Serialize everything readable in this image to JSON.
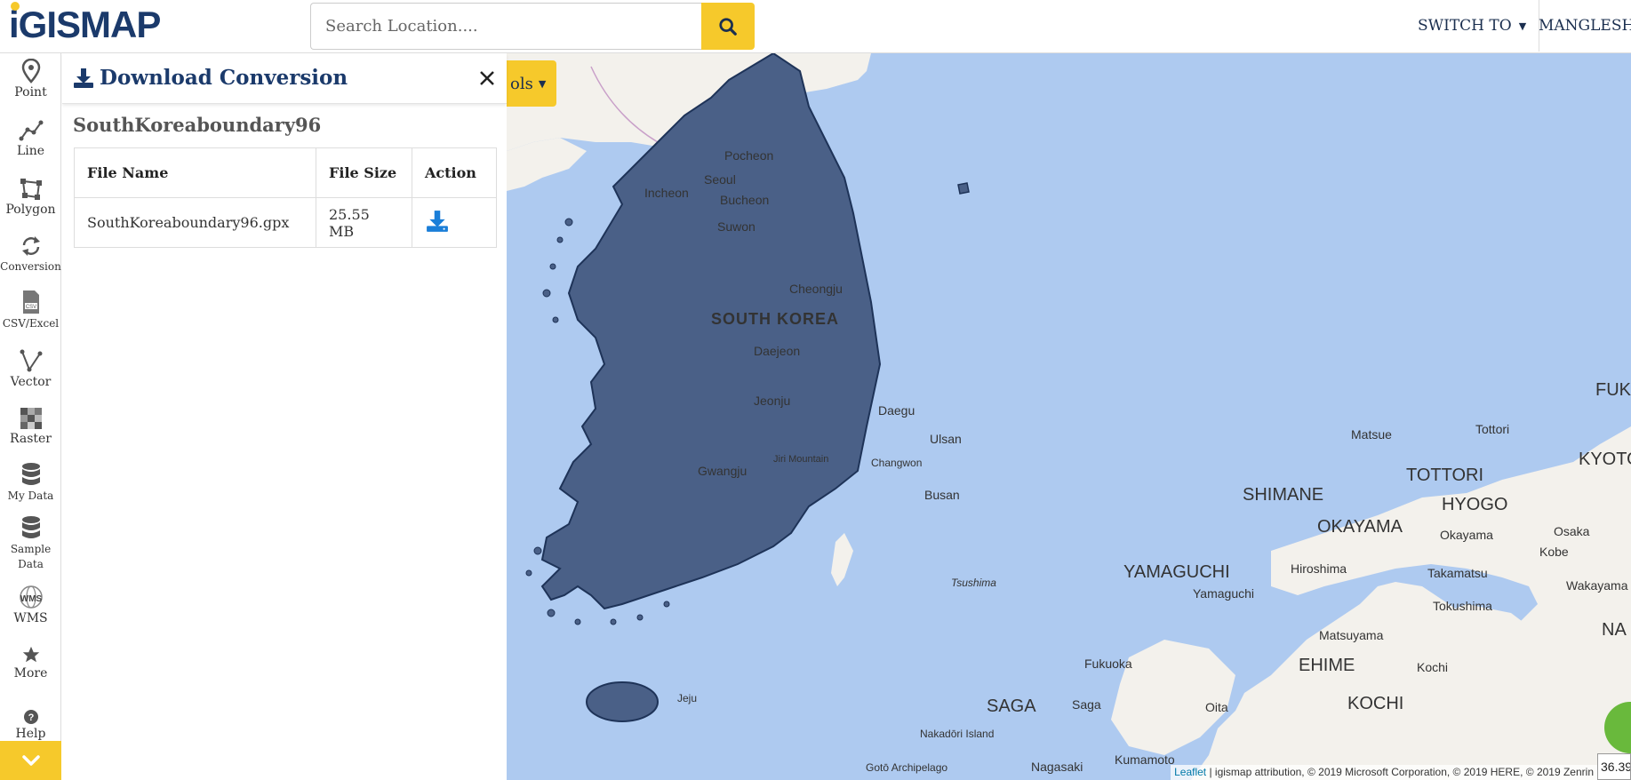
{
  "header": {
    "logo_text": "GISMAP",
    "logo_i": "i",
    "search_placeholder": "Search Location....",
    "search_icon": "search-icon",
    "switch_label": "SWITCH TO",
    "user_label": "MANGLESH KUMAR",
    "accent_color": "#f6c92b",
    "brand_color": "#1b3a6b"
  },
  "sidebar": {
    "items": [
      {
        "label": "Point",
        "icon": "map-pin-icon"
      },
      {
        "label": "Line",
        "icon": "line-icon"
      },
      {
        "label": "Polygon",
        "icon": "polygon-icon"
      },
      {
        "label": "Conversion",
        "icon": "conversion-icon"
      },
      {
        "label": "CSV/Excel",
        "icon": "csv-icon"
      },
      {
        "label": "Vector",
        "icon": "vector-icon"
      },
      {
        "label": "Raster",
        "icon": "raster-icon"
      },
      {
        "label": "My Data",
        "icon": "database-icon"
      },
      {
        "label": "Sample Data",
        "icon": "database-icon"
      },
      {
        "label": "WMS",
        "icon": "wms-icon"
      },
      {
        "label": "More",
        "icon": "star-icon"
      },
      {
        "label": "Help",
        "icon": "help-icon"
      }
    ],
    "collapse_icon": "chevron-down-icon"
  },
  "panel": {
    "title": "Download Conversion",
    "dataset_name": "SouthKoreaboundary96",
    "columns": [
      "File Name",
      "File Size",
      "Action"
    ],
    "rows": [
      {
        "file_name": "SouthKoreaboundary96.gpx",
        "file_size": "25.55 MB",
        "action_icon": "download-icon"
      }
    ]
  },
  "map": {
    "tools_label": "ols",
    "labels": {
      "south_korea": "SOUTH KOREA",
      "pocheon": "Pocheon",
      "seoul": "Seoul",
      "incheon": "Incheon",
      "bucheon": "Bucheon",
      "suwon": "Suwon",
      "cheongju": "Cheongju",
      "daejeon": "Daejeon",
      "jeonju": "Jeonju",
      "daegu": "Daegu",
      "ulsan": "Ulsan",
      "gwangju": "Gwangju",
      "jiri": "Jiri Mountain",
      "changwon": "Changwon",
      "busan": "Busan",
      "jeju": "Jeju",
      "tsushima": "Tsushima",
      "matsue": "Matsue",
      "tottori_city": "Tottori",
      "shimane": "SHIMANE",
      "tottori": "TOTTORI",
      "hyogo": "HYOGO",
      "kyoto": "KYOTO",
      "okayama": "OKAYAMA",
      "okayama_city": "Okayama",
      "osaka": "Osaka",
      "kobe": "Kobe",
      "yamaguchi": "YAMAGUCHI",
      "yamaguchi_city": "Yamaguchi",
      "hiroshima": "Hiroshima",
      "takamatsu": "Takamatsu",
      "tokushima": "Tokushima",
      "wakayama": "Wakayama",
      "matsuyama": "Matsuyama",
      "ehime": "EHIME",
      "kochi_city": "Kochi",
      "kochi": "KOCHI",
      "fukuoka": "Fukuoka",
      "saga": "SAGA",
      "saga_city": "Saga",
      "oita": "Oita",
      "kumamoto": "Kumamoto",
      "nagasaki": "Nagasaki",
      "nakadori": "Nakadōri Island",
      "goto": "Gotō Archipelago",
      "fuk": "FUK",
      "na": "NA"
    },
    "attribution_link": "Leaflet",
    "attribution_text": " | igismap attribution, © 2019 Microsoft Corporation, © 2019 HERE, © 2019 Zenrin",
    "coord": "36.39",
    "water_color": "#aecaf0",
    "land_color": "#f3f1ec",
    "boundary_fill": "#4a6087"
  }
}
